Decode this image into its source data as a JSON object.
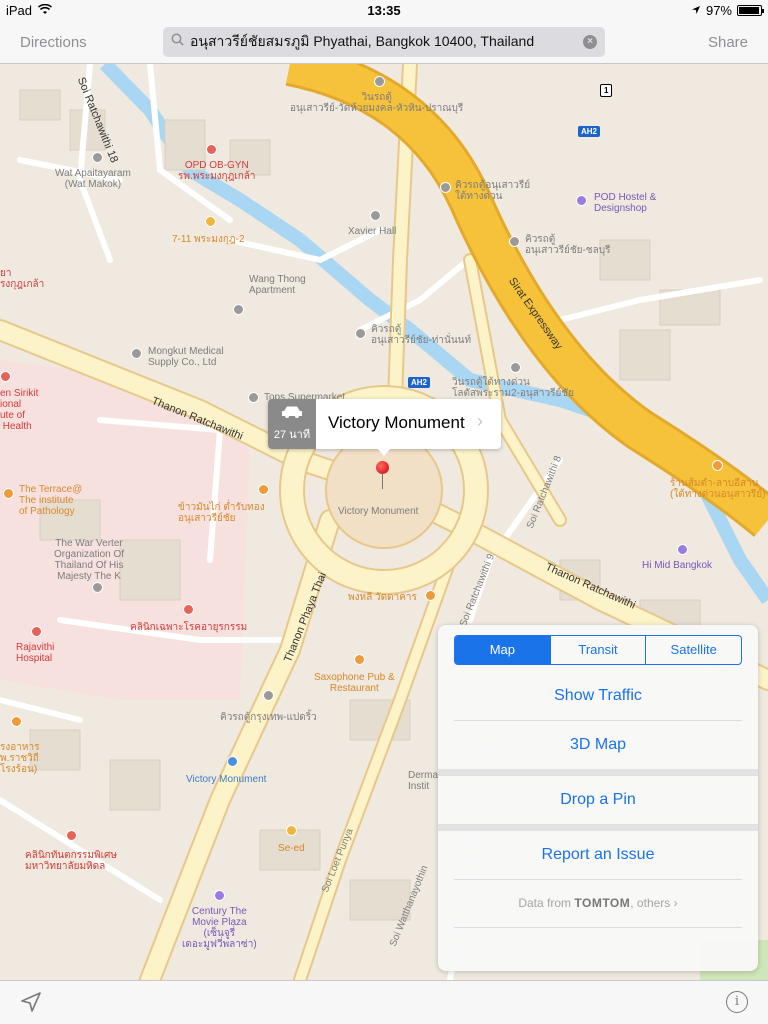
{
  "status_bar": {
    "device": "iPad",
    "time": "13:35",
    "battery": "97%",
    "battery_level": 0.97
  },
  "nav": {
    "directions": "Directions",
    "share": "Share",
    "search_text": "อนุสาวรีย์ชัยสมรภูมิ Phyathai, Bangkok 10400, Thailand"
  },
  "callout": {
    "eta": "27 นาที",
    "title": "Victory Monument"
  },
  "panel": {
    "tabs": [
      {
        "label": "Map",
        "active": true
      },
      {
        "label": "Transit",
        "active": false
      },
      {
        "label": "Satellite",
        "active": false
      }
    ],
    "show_traffic": "Show Traffic",
    "map_3d": "3D Map",
    "drop_pin": "Drop a Pin",
    "report_issue": "Report an Issue",
    "attribution": {
      "prefix": "Data from",
      "brand": "TOMTOM",
      "suffix": ", others",
      "chevron": "›"
    }
  },
  "map": {
    "pois": {
      "soi_ratchawithi_18": "Soi Ratchawithi 18",
      "wat_apaitayaram": "Wat Apaitayaram\n(Wat Makok)",
      "opd_ob_gyn": "OPD OB-GYN\nรพ.พระมงกุฎเกล้า",
      "seven_eleven": "7-11 พระมงกุฎ-2",
      "xavier_hall": "Xavier Hall",
      "wang_thong": "Wang Thong\nApartment",
      "mongkut": "Mongkut Medical\nSupply Co., Ltd",
      "pod_hostel": "POD Hostel &\nDesignshop",
      "winrot": "วินรถตู้\nอนุเสาวรีย์-วัดห้วยมงคล-หัวหิน-ปราณบุรี",
      "bus_stop_top": "คิวรถตู้อนุเสาวรีย์\nใต้ทางด่วน",
      "bus_stop_chonburi": "คิวรถตู้\nอนุเสาวรีย์ชัย-ชลบุรี",
      "bus_stop_thananon": "คิวรถตู้\nอนุเสาวรีย์ชัย-ท่านั่นนท์",
      "tops": "Tops Supermarket",
      "winrot_right": "วินรถตู้ใต้ทางด่วน\nโลตัสพระราม2-อนุสาวรีย์ชัย",
      "sirikit": "en Sirikit\nional\nute of\n Health",
      "the_terrace": "The Terrace@\nThe institute\nof Pathology",
      "war_veterans": "The War Verter\nOrganization Of\nThailand Of His\nMajesty The K",
      "restaurant_thai": "ข้าวมันไก่ ต่ำรับทอง\nอนุเสาวรีย์ชัย",
      "victory_monument_lbl": "Victory Monument",
      "clinic_thai": "คลินิกเฉพาะโรคอายุรกรรม",
      "rajavithi": "Rajavithi\nHospital",
      "pongla": "พงหลี วัดดาคาร",
      "saxophone": "Saxophone Pub &\nRestaurant",
      "bus_bkk": "คิวรถตู้กรุงเทพ-แปดริ้ว",
      "victory_monument_station": "Victory Monument",
      "se_ed": "Se-ed",
      "dental_thai": "คลินิกทันตกรรมพิเศษ\nมหาวิทยาลัยมหิดล",
      "century": "Century The\nMovie Plaza\n(เซ็นจูรี่\nเดอะมูฟวี่พลาซ่า)",
      "hi_mid": "Hi Mid Bangkok",
      "right_food": "ร้านส้มตำ-ลาบอีสาน\n(ใต้ทางด่วนอนุสาวรีย์)",
      "left_food": "รงอาหาร\nพ.ราชวิถี\nโรงร้อน)",
      "dermatology": "Derma\nInstit",
      "thai_left": "ยา\nรงกุฎเกล้า"
    },
    "roads": {
      "soi_ratchawithi_8": "Soi Ratchawithi 8",
      "sirat": "Sirat Expressway",
      "thanon_ratchawithi_left": "Thanon Ratchawithi",
      "thanon_ratchawithi_right": "Thanon Ratchawithi",
      "phaya_thai": "Thanon Phaya Thai",
      "loet_punya": "Soi Loet Punya",
      "watthanayothin": "Soi Watthanayothin",
      "soi_9": "Soi Ratchawithi 9"
    },
    "shields": {
      "ah2_top": "AH2",
      "ah2_mid": "AH2",
      "route_1": "1"
    }
  },
  "colors": {
    "accent": "#1a73e8",
    "expressway": "#f5c23a",
    "expressway_edge": "#e3a92c",
    "major_road": "#fdf3c8",
    "minor_road": "#ffffff",
    "water": "#a9d6f2",
    "land": "#efe9df",
    "hospital_area": "#f7e1df",
    "callout_eta_bg": "#8a8a8a"
  },
  "icons": {
    "wifi": "wifi-icon",
    "location_arrow": "location-arrow-icon",
    "search": "search-icon",
    "clear": "clear-icon",
    "car": "car-icon",
    "pin": "red-pin-icon",
    "info": "info-icon"
  }
}
